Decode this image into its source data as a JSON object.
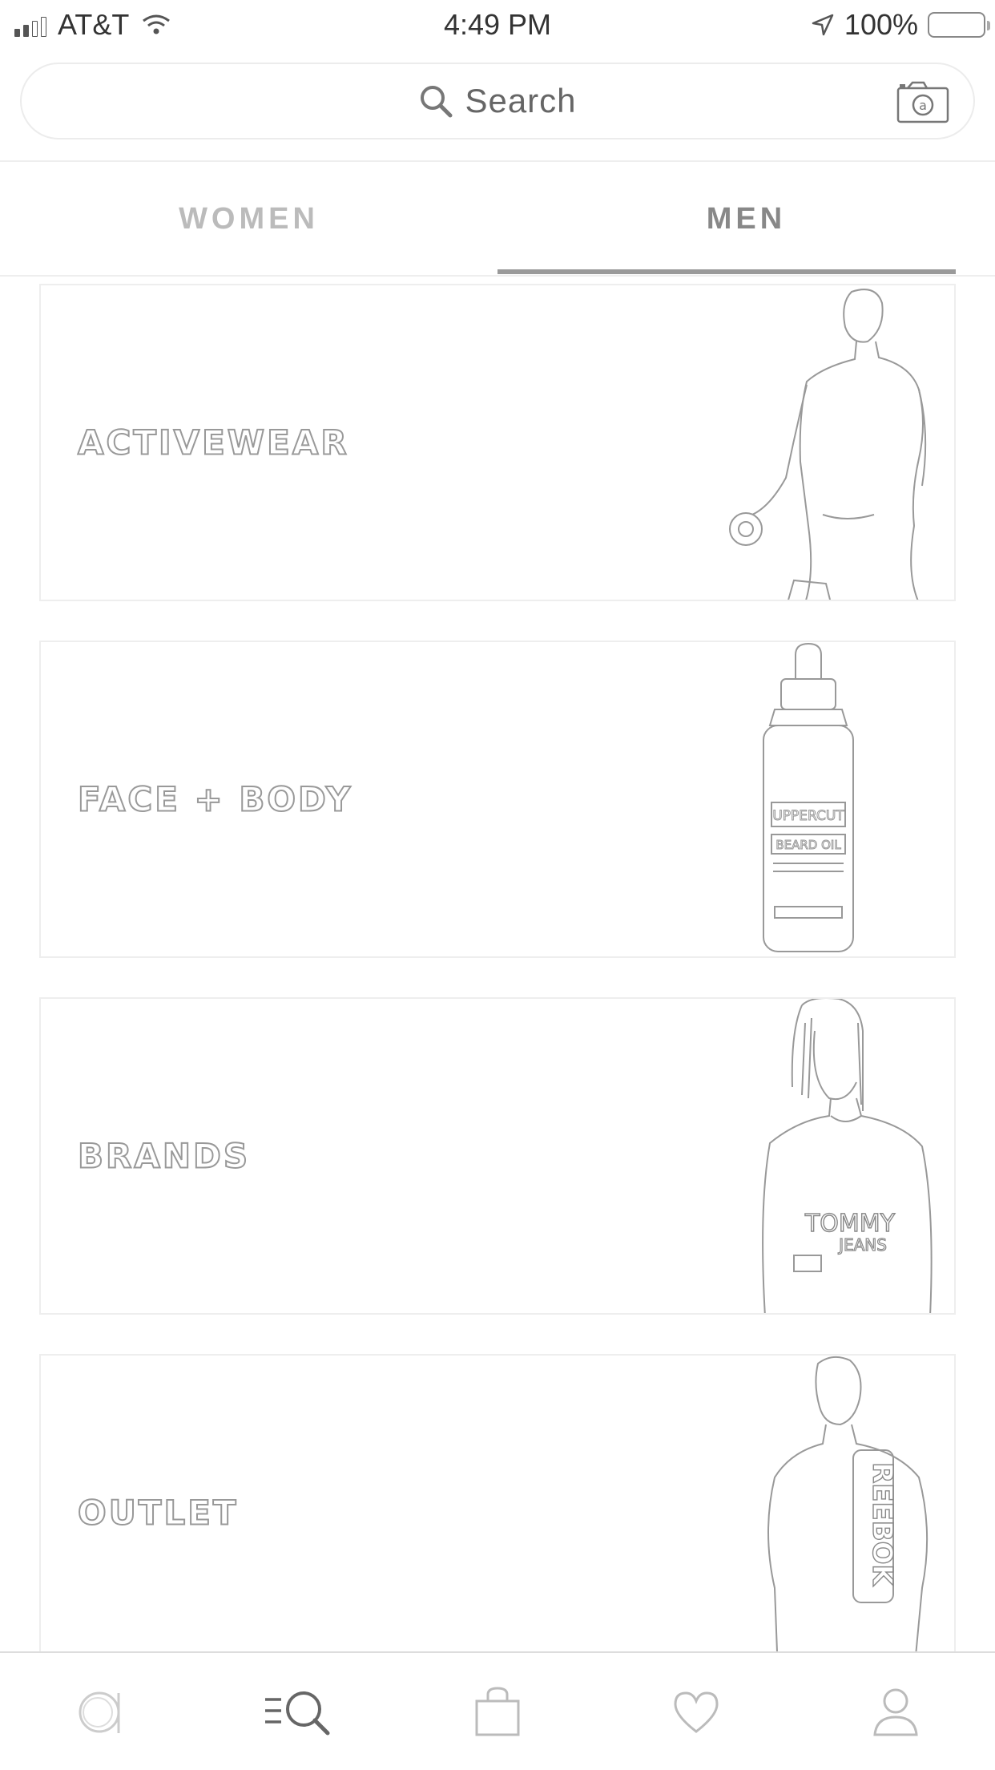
{
  "status_bar": {
    "carrier": "AT&T",
    "time": "4:49 PM",
    "battery": "100%",
    "icons": [
      "signal-icon",
      "wifi-icon",
      "location-arrow-icon",
      "battery-icon"
    ]
  },
  "search": {
    "placeholder": "Search",
    "icons": [
      "search-icon",
      "camera-icon"
    ]
  },
  "tabs": [
    {
      "label": "WOMEN",
      "selected": false
    },
    {
      "label": "MEN",
      "selected": true
    }
  ],
  "categories": [
    {
      "label": "ACTIVEWEAR",
      "image": "man-with-dumbbell-image"
    },
    {
      "label": "FACE + BODY",
      "image": "beard-oil-bottle-image",
      "image_text": [
        "UPPERCUT",
        "BEARD OIL"
      ]
    },
    {
      "label": "BRANDS",
      "image": "man-in-tommy-jeans-tee-image",
      "image_text": [
        "TOMMY",
        "JEANS"
      ]
    },
    {
      "label": "OUTLET",
      "image": "man-in-reebok-tee-image",
      "image_text": [
        "REEBOK"
      ]
    }
  ],
  "tab_bar": {
    "items": [
      {
        "name": "home",
        "icon": "asos-logo-icon",
        "selected": false
      },
      {
        "name": "search",
        "icon": "search-list-icon",
        "selected": true
      },
      {
        "name": "bag",
        "icon": "bag-icon",
        "selected": false
      },
      {
        "name": "saved",
        "icon": "heart-icon",
        "selected": false
      },
      {
        "name": "account",
        "icon": "person-icon",
        "selected": false
      }
    ]
  },
  "colors": {
    "accent": "#9a9a9a",
    "border": "#eeeeee",
    "text": "#444444"
  }
}
